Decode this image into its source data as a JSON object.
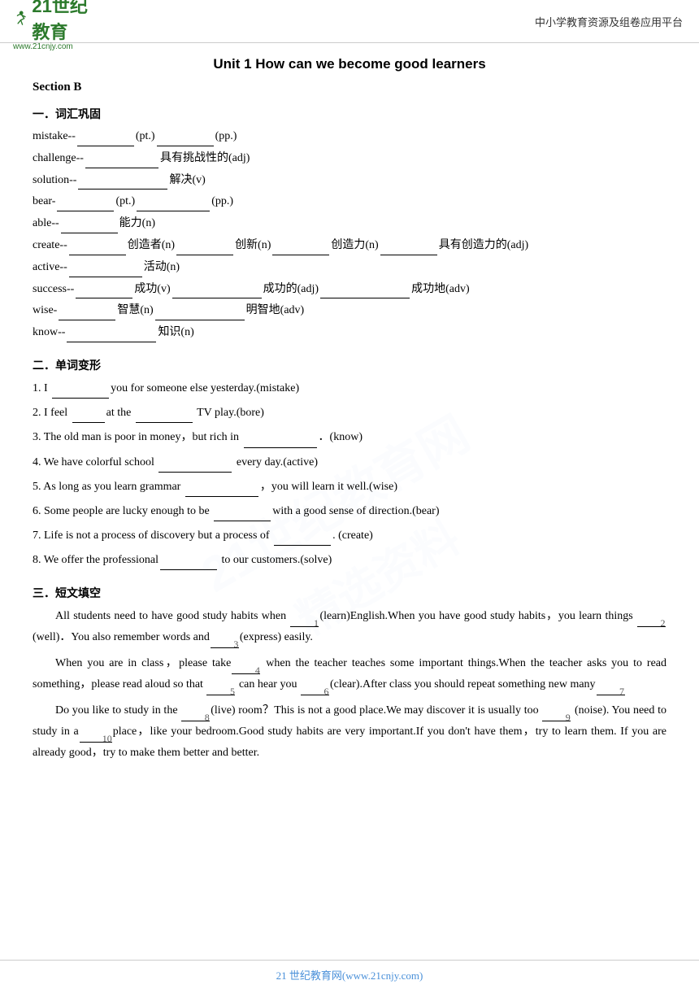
{
  "header": {
    "logo_text_21": "21世纪教育",
    "logo_url": "www.21cnjy.com",
    "header_right": "中小学教育资源及组卷应用平台"
  },
  "main_title": "Unit 1 How can we become good learners",
  "section_b": "Section B",
  "sections": [
    {
      "id": "one",
      "label": "一．词汇巩固",
      "items": [
        "mistake--__________(pt.)__________(pp.)",
        "challenge--__________ 具有挑战性的(adj)",
        "solution--____________ 解决(v)",
        "bear-__________(pt.)__________(pp.)",
        "able--__________ 能力(n)",
        "create--________创造者(n)__________创新(n)__________创造力(n)________具有创造力的(adj)",
        "active--__________ 活动(n)",
        "success--__________成功(v)____________成功的(adj)____________成功地(adv)",
        "wise-__________智慧(n)____________明智地(adv)",
        "know--____________知识(n)"
      ]
    },
    {
      "id": "two",
      "label": "二．单词变形",
      "items": [
        "1. I ________you for someone else yesterday.(mistake)",
        "2. I feel ________at the _________ TV play.(bore)",
        "3. The old man is poor in money，but rich in _________．(know)",
        "4. We have colorful school _________ every day.(active)",
        "5. As long as you learn grammar _________，you will learn it well.(wise)",
        "6. Some people are lucky enough to be ________with a good sense of direction.(bear)",
        "7. Life is not a process of discovery but a process of _________. (create)",
        "8. We offer the professional_______ to our customers.(solve)"
      ]
    },
    {
      "id": "three",
      "label": "三．短文填空",
      "passage": [
        {
          "text": "All students need to have good study habits when ____1___(learn)English.When you have good study habits，you learn things ___2____ (well)．You also remember words and____3___(express) easily."
        },
        {
          "text": "When you are in class，please take____4____ when the teacher teaches some important things.When the teacher asks you to read something，please read aloud so that ___5____ can hear you ____6___(clear).After class you should repeat something new many______7____"
        },
        {
          "text": "Do you like to study in the ____8___(live) room？This is not a good place.We may discover it is usually too ____9____ (noise). You need to study in a_____10____place，like your bedroom.Good study habits are very important.If you don't have them，try to learn them. If you are already good，try to make them better and better."
        }
      ]
    }
  ],
  "footer": {
    "text": "21 世纪教育网(www.21cnjy.com)"
  },
  "watermark": {
    "line1": "21世纪教育网",
    "line2": "精选资料"
  }
}
